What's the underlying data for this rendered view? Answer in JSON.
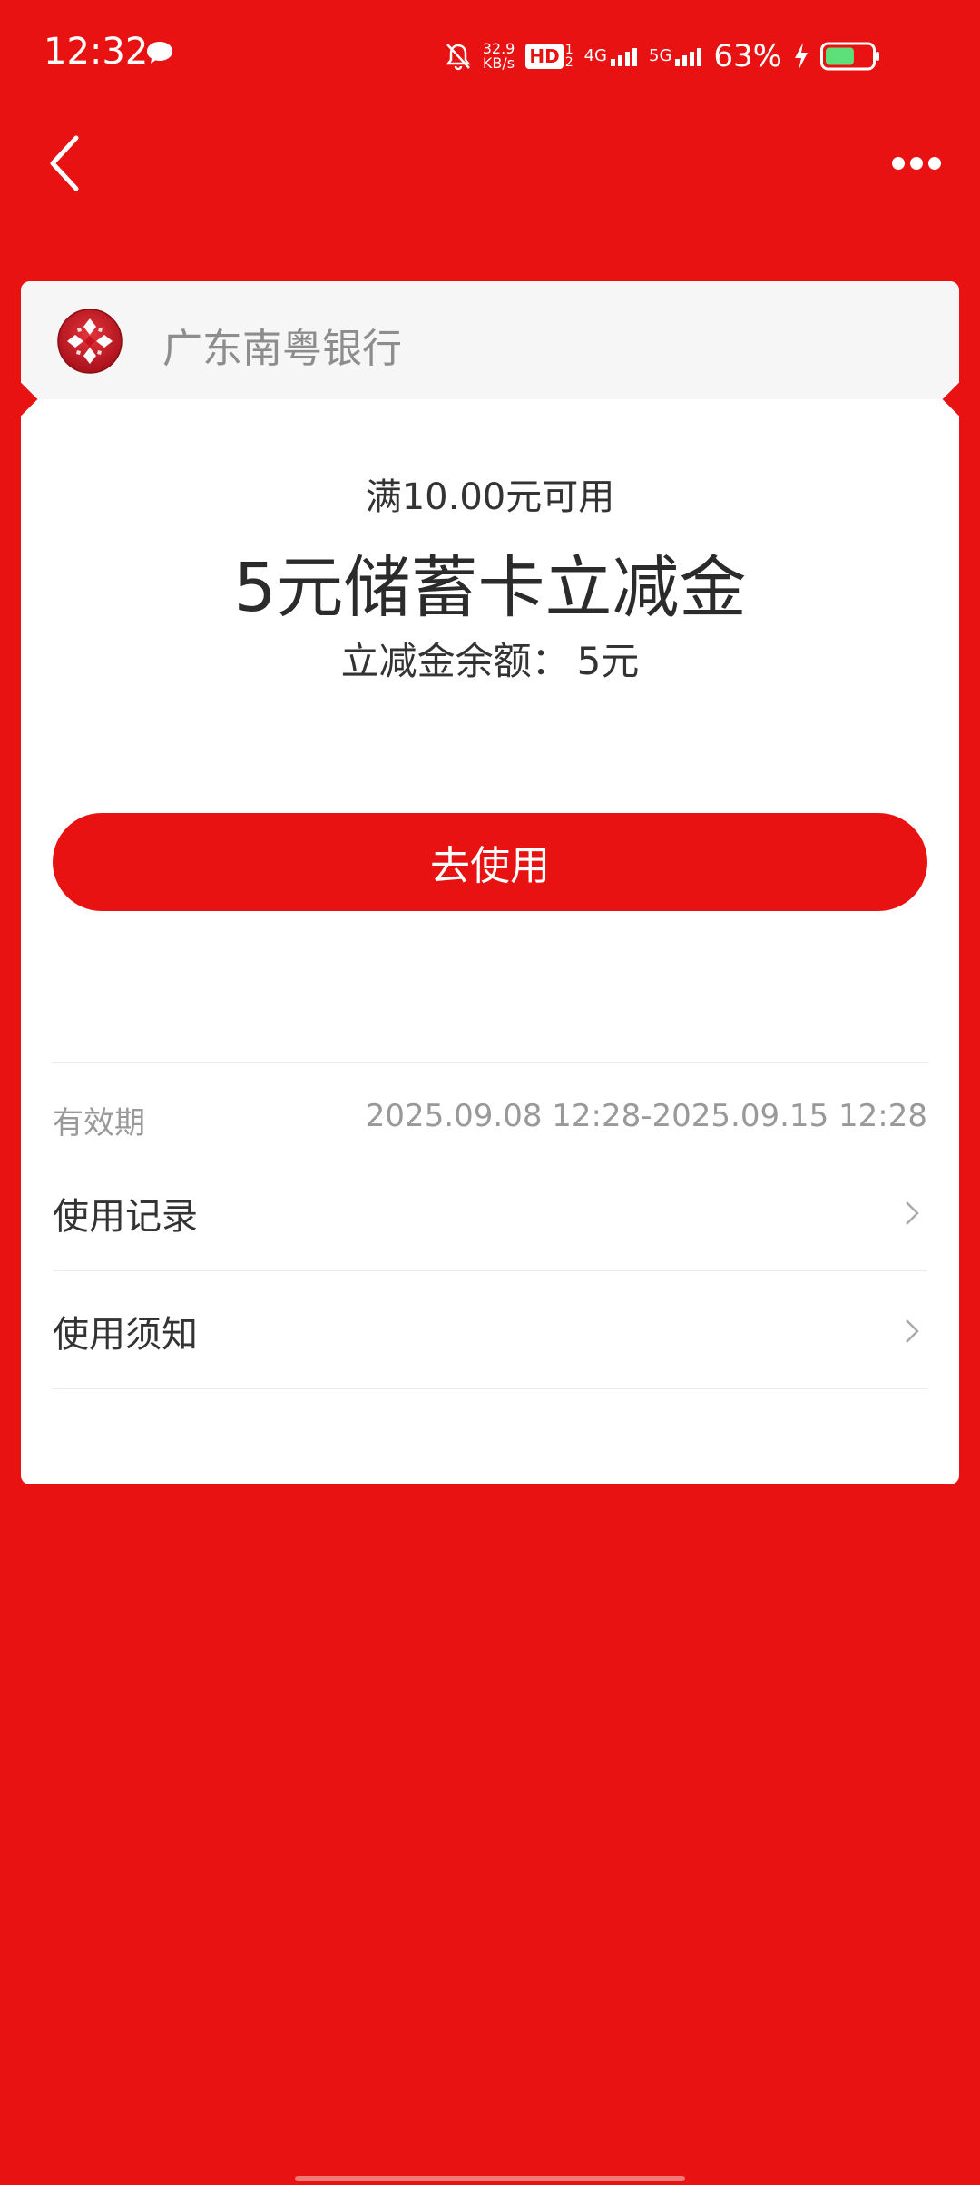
{
  "status_bar": {
    "time": "12:32",
    "net_speed_value": "32.9",
    "net_speed_unit": "KB/s",
    "hd": "HD",
    "net1": "4G",
    "net2": "5G",
    "battery_pct": "63%",
    "battery_level": 0.63
  },
  "icons": {
    "chat": "chat-bubble-icon",
    "mute": "bell-off-icon",
    "back": "chevron-left-icon",
    "more": "more-dots-icon",
    "chevron": "chevron-right-icon",
    "logo": "bank-logo"
  },
  "colors": {
    "brand_red": "#e81212",
    "card_bg": "#ffffff",
    "header_bg": "#f6f6f6"
  },
  "card": {
    "bank_name": "广东南粤银行",
    "condition": "满10.00元可用",
    "title": "5元储蓄卡立减金",
    "balance_label": "立减金余额：",
    "balance_value": "5元",
    "use_button": "去使用",
    "validity_label": "有效期",
    "validity_value": "2025.09.08 12:28-2025.09.15 12:28",
    "rows": [
      {
        "label": "使用记录"
      },
      {
        "label": "使用须知"
      }
    ]
  }
}
